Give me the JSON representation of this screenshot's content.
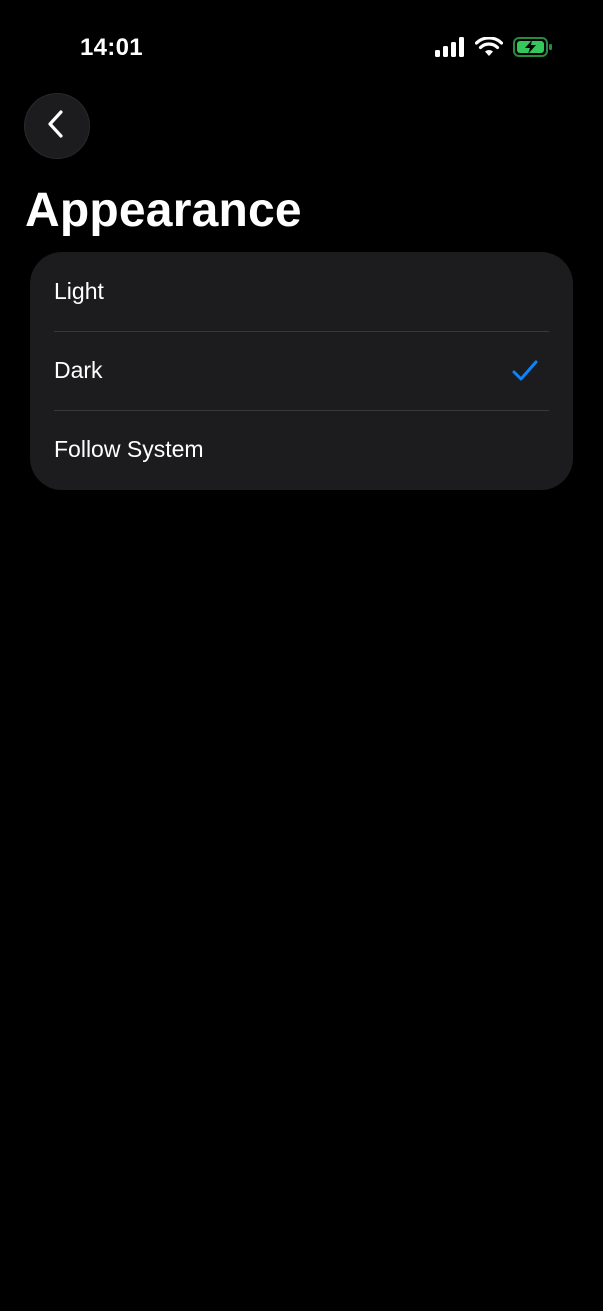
{
  "status_bar": {
    "time": "14:01",
    "icons": [
      "cellular-signal-icon",
      "wifi-icon",
      "battery-charging-icon"
    ],
    "battery_color": "#34c759"
  },
  "header": {
    "back_icon": "chevron-left-icon",
    "title": "Appearance"
  },
  "appearance_options": [
    {
      "label": "Light",
      "selected": false
    },
    {
      "label": "Dark",
      "selected": true
    },
    {
      "label": "Follow System",
      "selected": false
    }
  ],
  "colors": {
    "background": "#000000",
    "card": "#1c1c1e",
    "separator": "#38383a",
    "accent": "#0a84ff",
    "text": "#ffffff"
  }
}
